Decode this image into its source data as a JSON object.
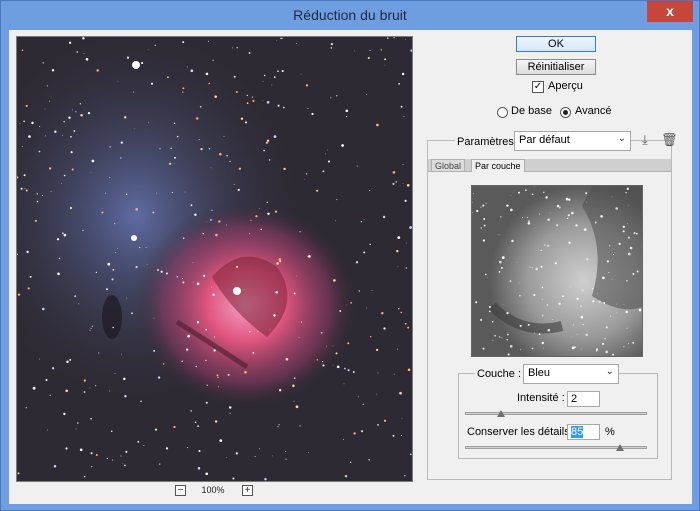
{
  "window": {
    "title": "Réduction du bruit",
    "close_label": "x"
  },
  "preview": {
    "zoom_value": "100%",
    "zoom_out_label": "−",
    "zoom_in_label": "+"
  },
  "buttons": {
    "ok": "OK",
    "reset": "Réinitialiser"
  },
  "apercu": {
    "label": "Aperçu",
    "checked": true
  },
  "mode": {
    "basic": "De base",
    "advanced": "Avancé",
    "selected": "advanced"
  },
  "parametres": {
    "label": "Paramètres :",
    "value": "Par défaut"
  },
  "tabs": [
    {
      "label": "Global",
      "active": false
    },
    {
      "label": "Par couche",
      "active": true
    }
  ],
  "couche": {
    "label": "Couche :",
    "value": "Bleu"
  },
  "intensite": {
    "label": "Intensité :",
    "value": "2",
    "slider_fraction": 0.2
  },
  "conserver": {
    "label": "Conserver les détails :",
    "value": "85",
    "unit": "%",
    "slider_fraction": 0.85
  }
}
